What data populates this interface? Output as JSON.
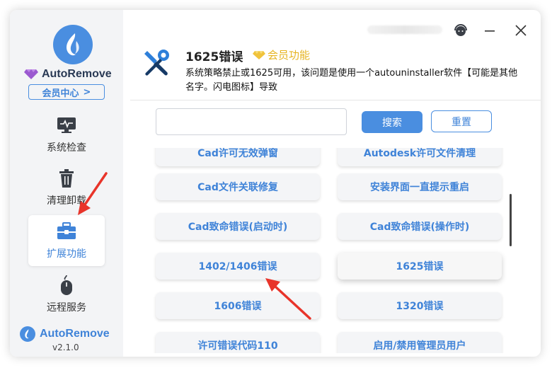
{
  "sidebar": {
    "brand": "AutoRemove",
    "member_center": "会员中心",
    "member_center_chevron": ">",
    "items": [
      {
        "label": "系统检查",
        "icon": "monitor-icon"
      },
      {
        "label": "清理卸载",
        "icon": "trash-icon"
      },
      {
        "label": "扩展功能",
        "icon": "toolbox-icon",
        "active": true
      },
      {
        "label": "远程服务",
        "icon": "mouse-icon"
      }
    ],
    "bottom_brand": "AutoRemove",
    "version": "v2.1.0"
  },
  "titlebar": {
    "icons": [
      "support-headset-icon",
      "minimize-icon",
      "close-icon"
    ]
  },
  "detail": {
    "title": "1625错误",
    "vip_label": "会员功能",
    "description": "系统策略禁止或1625可用，该问题是使用一个autouninstaller软件【可能是其他名字。闪电图标】导致"
  },
  "search": {
    "placeholder": "",
    "search_label": "搜索",
    "reset_label": "重置"
  },
  "list": {
    "items": [
      "Cad许可无效弹窗",
      "Autodesk许可文件清理",
      "Cad文件关联修复",
      "安装界面一直提示重启",
      "Cad致命错误(启动时)",
      "Cad致命错误(操作时)",
      "1402/1406错误",
      "1625错误",
      "1606错误",
      "1320错误",
      "许可错误代码110",
      "启用/禁用管理员用户"
    ],
    "selected": "1625错误"
  },
  "colors": {
    "accent": "#4a8ee0",
    "vip_gold": "#e6b422",
    "annotation_red": "#e8342a"
  }
}
